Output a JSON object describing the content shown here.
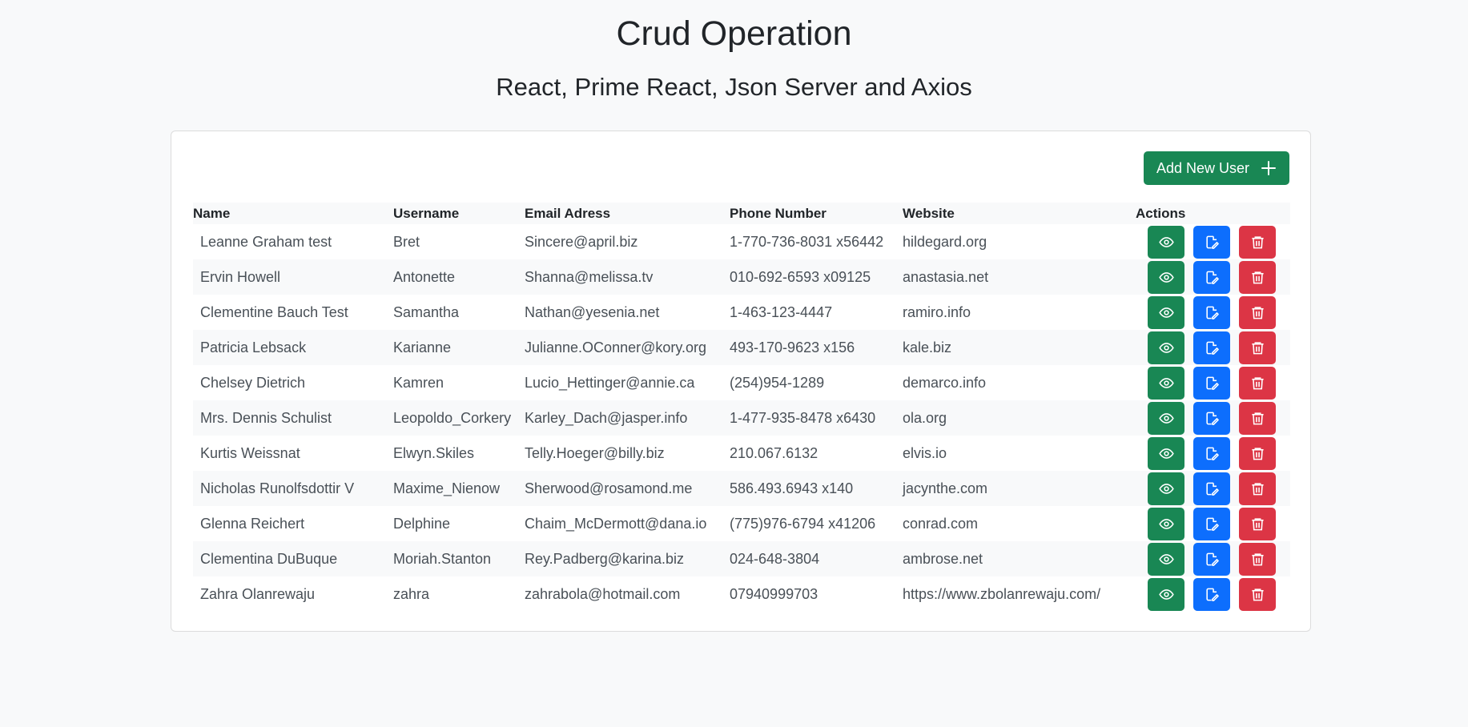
{
  "header": {
    "title": "Crud Operation",
    "subtitle": "React, Prime React, Json Server and Axios"
  },
  "toolbar": {
    "add_label": "Add New User",
    "add_icon": "plus-icon",
    "add_color": "#198754"
  },
  "table": {
    "columns": [
      "Name",
      "Username",
      "Email Adress",
      "Phone Number",
      "Website",
      "Actions"
    ],
    "rows": [
      {
        "name": "Leanne Graham test",
        "username": "Bret",
        "email": "Sincere@april.biz",
        "phone": "1-770-736-8031 x56442",
        "website": "hildegard.org"
      },
      {
        "name": "Ervin Howell",
        "username": "Antonette",
        "email": "Shanna@melissa.tv",
        "phone": "010-692-6593 x09125",
        "website": "anastasia.net"
      },
      {
        "name": "Clementine Bauch Test",
        "username": "Samantha",
        "email": "Nathan@yesenia.net",
        "phone": "1-463-123-4447",
        "website": "ramiro.info"
      },
      {
        "name": "Patricia Lebsack",
        "username": "Karianne",
        "email": "Julianne.OConner@kory.org",
        "phone": "493-170-9623 x156",
        "website": "kale.biz"
      },
      {
        "name": "Chelsey Dietrich",
        "username": "Kamren",
        "email": "Lucio_Hettinger@annie.ca",
        "phone": "(254)954-1289",
        "website": "demarco.info"
      },
      {
        "name": "Mrs. Dennis Schulist",
        "username": "Leopoldo_Corkery",
        "email": "Karley_Dach@jasper.info",
        "phone": "1-477-935-8478 x6430",
        "website": "ola.org"
      },
      {
        "name": "Kurtis Weissnat",
        "username": "Elwyn.Skiles",
        "email": "Telly.Hoeger@billy.biz",
        "phone": "210.067.6132",
        "website": "elvis.io"
      },
      {
        "name": "Nicholas Runolfsdottir V",
        "username": "Maxime_Nienow",
        "email": "Sherwood@rosamond.me",
        "phone": "586.493.6943 x140",
        "website": "jacynthe.com"
      },
      {
        "name": "Glenna Reichert",
        "username": "Delphine",
        "email": "Chaim_McDermott@dana.io",
        "phone": "(775)976-6794 x41206",
        "website": "conrad.com"
      },
      {
        "name": "Clementina DuBuque",
        "username": "Moriah.Stanton",
        "email": "Rey.Padberg@karina.biz",
        "phone": "024-648-3804",
        "website": "ambrose.net"
      },
      {
        "name": "Zahra Olanrewaju",
        "username": "zahra",
        "email": "zahrabola@hotmail.com",
        "phone": "07940999703",
        "website": "https://www.zbolanrewaju.com/"
      }
    ],
    "actions": [
      {
        "icon": "eye-icon",
        "color": "#198754"
      },
      {
        "icon": "edit-icon",
        "color": "#0d6efd"
      },
      {
        "icon": "trash-icon",
        "color": "#dc3545"
      }
    ]
  }
}
